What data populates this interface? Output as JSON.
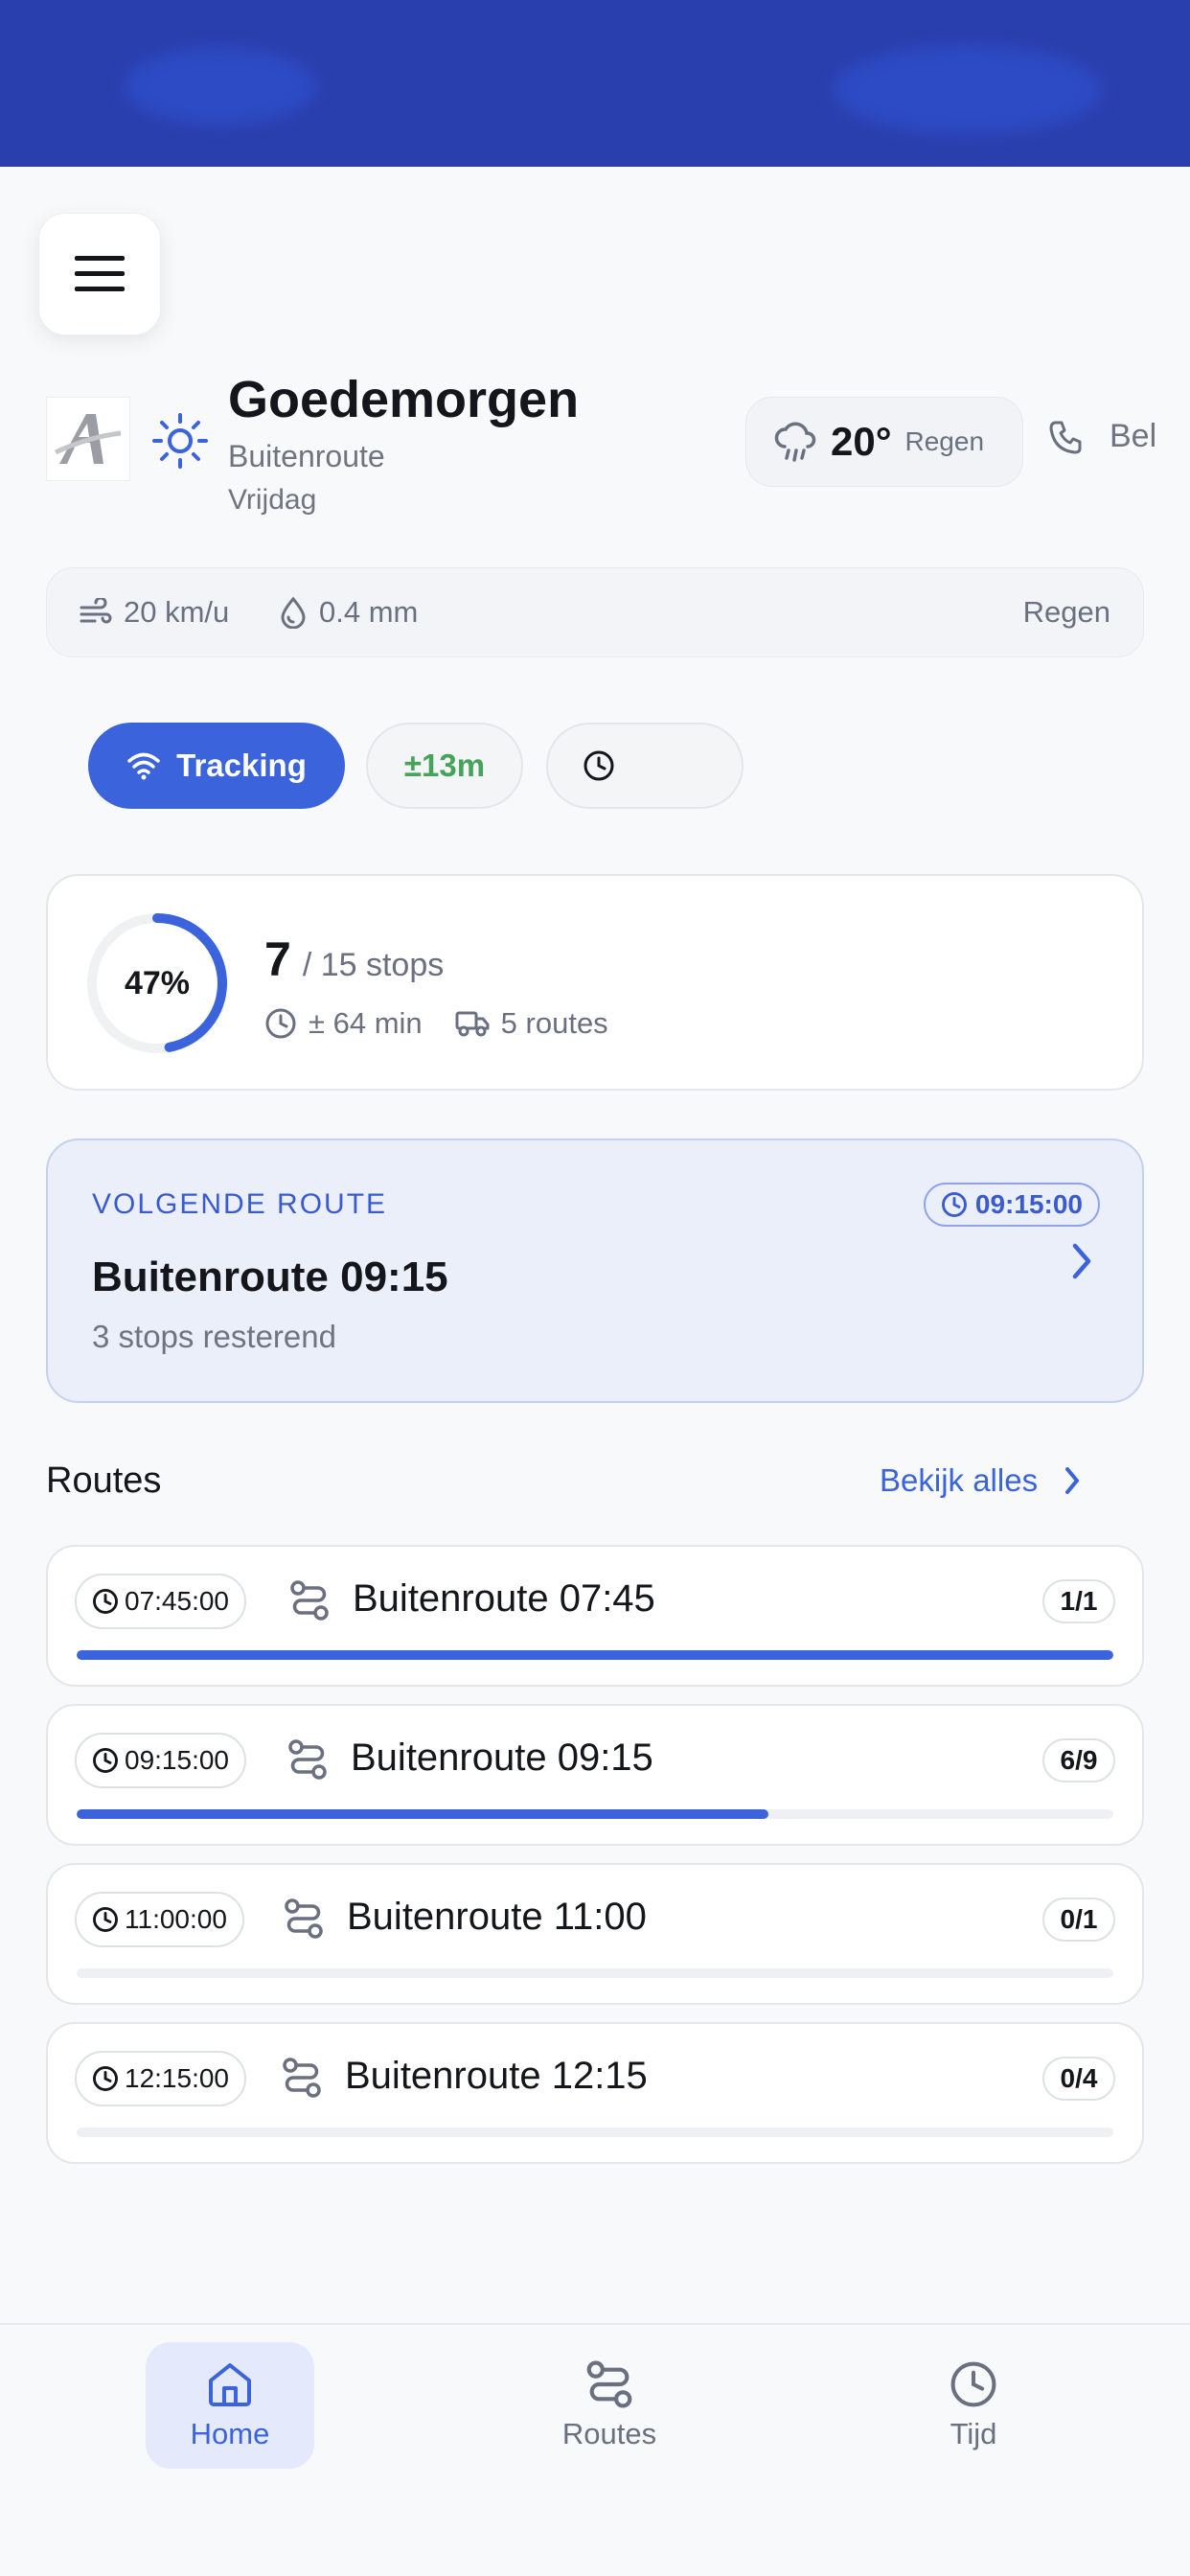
{
  "colors": {
    "accent": "#3a63dc",
    "header": "#2a3fae",
    "success": "#45a35a",
    "muted": "#6b7080"
  },
  "header": {
    "greeting": "Goedemorgen",
    "route": "Buitenroute",
    "day": "Vrijdag",
    "weather_icon": "sun-icon",
    "logo_icon": "company-logo-icon"
  },
  "weather": {
    "temperature": "20°",
    "condition": "Regen",
    "icon": "rain-cloud-icon"
  },
  "call": {
    "label": "Bel",
    "icon": "phone-icon"
  },
  "metrics": {
    "wind": "20 km/u",
    "rain": "0.4 mm",
    "condition": "Regen"
  },
  "chips": {
    "tracking": "Tracking",
    "accuracy": "±13m",
    "clock_icon": "clock-icon"
  },
  "progress": {
    "percent_label": "47%",
    "percent": 47,
    "stops_done": "7",
    "stops_total": "/ 15 stops",
    "duration": "± 64 min",
    "routes": "5 routes"
  },
  "next_route": {
    "label": "VOLGENDE ROUTE",
    "time": "09:15:00",
    "title": "Buitenroute 09:15",
    "subtitle": "3 stops resterend"
  },
  "routes_section": {
    "title": "Routes",
    "view_all": "Bekijk alles"
  },
  "routes": [
    {
      "time": "07:45:00",
      "name": "Buitenroute 07:45",
      "count": "1/1",
      "progress": 1.0
    },
    {
      "time": "09:15:00",
      "name": "Buitenroute 09:15",
      "count": "6/9",
      "progress": 0.667
    },
    {
      "time": "11:00:00",
      "name": "Buitenroute 11:00",
      "count": "0/1",
      "progress": 0
    },
    {
      "time": "12:15:00",
      "name": "Buitenroute 12:15",
      "count": "0/4",
      "progress": 0
    }
  ],
  "nav": {
    "home": "Home",
    "routes": "Routes",
    "time": "Tijd"
  }
}
